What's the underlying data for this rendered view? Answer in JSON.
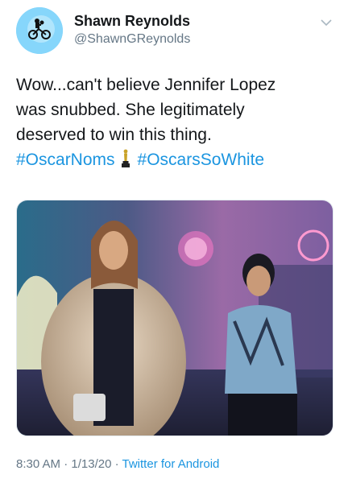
{
  "author": {
    "name": "Shawn Reynolds",
    "handle": "@ShawnGReynolds",
    "avatar_icon": "et-bicycle-moon-icon"
  },
  "tweet": {
    "lines": [
      "Wow...can't believe Jennifer Lopez",
      "was snubbed. She legitimately",
      "deserved to win this thing."
    ],
    "hashtags": [
      "#OscarNoms",
      "#OscarsSoWhite"
    ],
    "emoji_icon": "oscar-statue-icon"
  },
  "media": {
    "icon": "movie-still-photo"
  },
  "meta": {
    "time": "8:30 AM",
    "date": "1/13/20",
    "separator": "·",
    "source": "Twitter for Android"
  },
  "colors": {
    "link": "#1b95e0",
    "secondary_text": "#657786",
    "primary_text": "#14171a"
  }
}
